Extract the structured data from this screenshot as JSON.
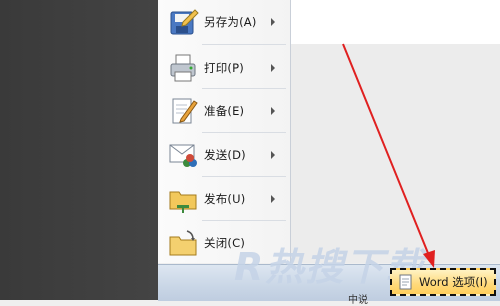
{
  "menu": {
    "items": [
      {
        "label": "另存为(A)",
        "icon": "save-as-icon",
        "has_submenu": true
      },
      {
        "label": "打印(P)",
        "icon": "printer-icon",
        "has_submenu": true
      },
      {
        "label": "准备(E)",
        "icon": "prepare-document-icon",
        "has_submenu": true
      },
      {
        "label": "发送(D)",
        "icon": "send-icon",
        "has_submenu": true
      },
      {
        "label": "发布(U)",
        "icon": "publish-icon",
        "has_submenu": true
      },
      {
        "label": "关闭(C)",
        "icon": "close-folder-icon",
        "has_submenu": false
      }
    ]
  },
  "bottom_bar": {
    "word_options_label": "Word 选项(I)",
    "partial_text": "中说"
  },
  "watermark": {
    "text": "R热搜下载"
  },
  "colors": {
    "annotation_arrow": "#e02020",
    "highlight": "#ffd97a"
  }
}
